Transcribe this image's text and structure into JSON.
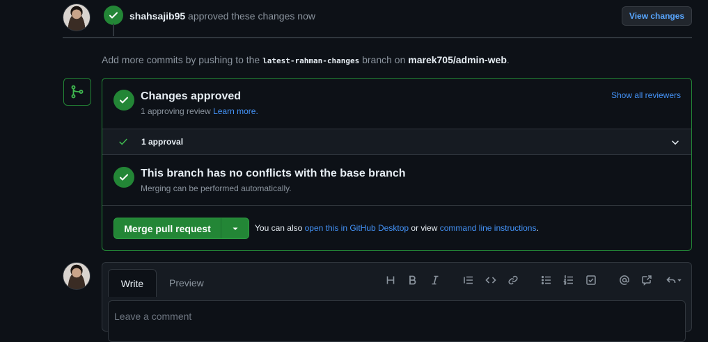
{
  "review_event": {
    "username": "shahsajib95",
    "action": "approved these changes",
    "time": "now",
    "view_changes_label": "View changes"
  },
  "push_hint": {
    "prefix": "Add more commits by pushing to the",
    "branch": "latest-rahman-changes",
    "middle": "branch on",
    "repo": "marek705/admin-web",
    "suffix": "."
  },
  "merge_box": {
    "approved_title": "Changes approved",
    "approved_sub_prefix": "1 approving review",
    "learn_more": "Learn more.",
    "show_all_reviewers": "Show all reviewers",
    "approval_count_label": "1 approval",
    "conflicts_title": "This branch has no conflicts with the base branch",
    "conflicts_sub": "Merging can be performed automatically.",
    "merge_button_label": "Merge pull request",
    "also_prefix": "You can also",
    "desktop_link": "open this in GitHub Desktop",
    "or_view": "or view",
    "cli_link": "command line instructions",
    "also_suffix": "."
  },
  "comment": {
    "tab_write": "Write",
    "tab_preview": "Preview",
    "placeholder": "Leave a comment",
    "toolbar_icons": [
      "heading-icon",
      "bold-icon",
      "italic-icon",
      "quote-icon",
      "code-icon",
      "link-icon",
      "unordered-list-icon",
      "ordered-list-icon",
      "task-list-icon",
      "mention-icon",
      "cross-reference-icon",
      "saved-replies-icon"
    ]
  },
  "colors": {
    "background": "#0d1117",
    "success": "#238636",
    "link": "#4493f8",
    "muted": "#8b949e"
  }
}
